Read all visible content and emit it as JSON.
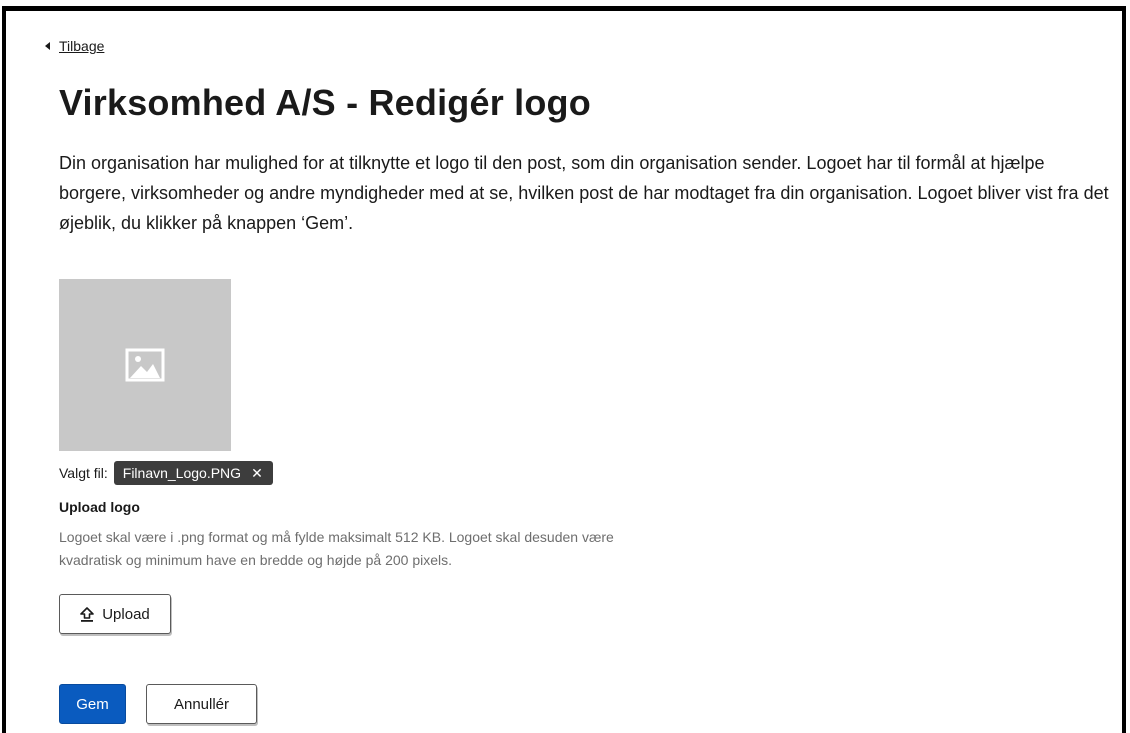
{
  "nav": {
    "back_label": "Tilbage"
  },
  "page": {
    "title": "Virksomhed A/S - Redigér logo",
    "intro": "Din organisation har mulighed for at tilknytte et logo til den post, som din organisation sender. Logoet har til formål at hjælpe borgere, virksomheder og andre myndigheder med at se, hvilken post de har modtaget fra din organisation. Logoet bliver vist fra det øjeblik, du klikker på knappen ‘Gem’."
  },
  "logo": {
    "placeholder_icon": "image-icon",
    "selected_label": "Valgt fil:",
    "selected_file": "Filnavn_Logo.PNG",
    "remove_icon": "close-icon"
  },
  "upload": {
    "label": "Upload logo",
    "help": "Logoet skal være i .png format og må fylde maksimalt 512 KB. Logoet skal desuden være kvadratisk og minimum have en bredde og højde på 200 pixels.",
    "button_label": "Upload",
    "button_icon": "upload-icon"
  },
  "actions": {
    "save_label": "Gem",
    "cancel_label": "Annullér"
  },
  "colors": {
    "primary": "#0a5bbf",
    "chip_bg": "#3d3d3d",
    "placeholder_bg": "#c8c8c8",
    "help_text": "#6e6e6e"
  }
}
